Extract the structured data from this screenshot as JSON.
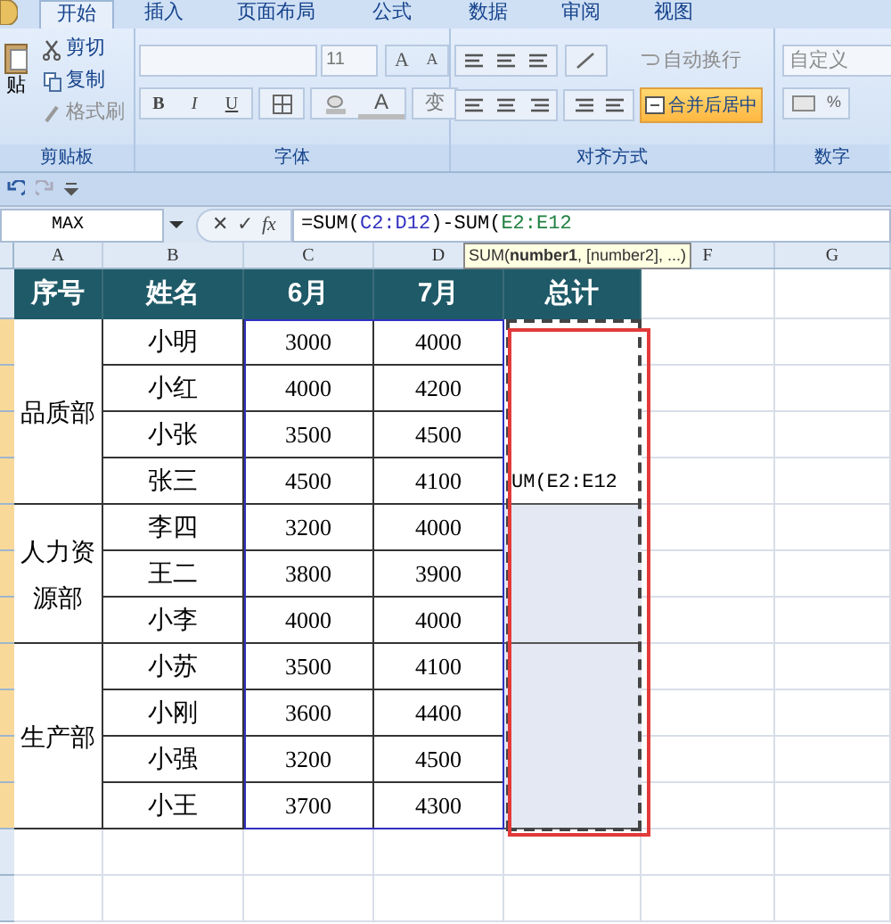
{
  "tabs": [
    {
      "label": "开始",
      "selected": true
    },
    {
      "label": "插入",
      "selected": false
    },
    {
      "label": "页面布局",
      "selected": false
    },
    {
      "label": "公式",
      "selected": false
    },
    {
      "label": "数据",
      "selected": false
    },
    {
      "label": "审阅",
      "selected": false
    },
    {
      "label": "视图",
      "selected": false
    }
  ],
  "clipboard": {
    "paste": "贴",
    "items": [
      {
        "label": "剪切",
        "disabled": false
      },
      {
        "label": "复制",
        "disabled": false
      },
      {
        "label": "格式刷",
        "disabled": true
      }
    ],
    "group_label": "剪贴板"
  },
  "font": {
    "size": "11",
    "grow": "A",
    "shrink": "A",
    "bold": "B",
    "italic": "I",
    "underline": "U",
    "font_color": "A",
    "phonetic": "变",
    "group_label": "字体"
  },
  "alignment": {
    "wrap": {
      "label": "自动换行",
      "disabled": true
    },
    "merge": {
      "label": "合并后居中",
      "selected": true
    },
    "group_label": "对齐方式"
  },
  "number": {
    "format": "自定义",
    "percent": "%",
    "group_label": "数字"
  },
  "formula_bar": {
    "name_box": "MAX",
    "cancel": "✕",
    "enter": "✓",
    "function": "fx",
    "parts": [
      {
        "text": "=SUM(",
        "color": "#000000"
      },
      {
        "text": "C2:D12",
        "color": "#3030c0"
      },
      {
        "text": ")-SUM(",
        "color": "#000000"
      },
      {
        "text": "E2:E12",
        "color": "#208040"
      }
    ]
  },
  "tooltip": "SUM(**number1**, [number2], ...)",
  "columns": [
    "A",
    "B",
    "C",
    "D",
    "F",
    "G"
  ],
  "header": [
    "序号",
    "姓名",
    "6月",
    "7月",
    "总计"
  ],
  "groups": [
    {
      "department": "品质部",
      "members": [
        {
          "name": "小明",
          "jun": "3000",
          "jul": "4000"
        },
        {
          "name": "小红",
          "jun": "4000",
          "jul": "4200"
        },
        {
          "name": "小张",
          "jun": "3500",
          "jul": "4500"
        },
        {
          "name": "张三",
          "jun": "4500",
          "jul": "4100"
        }
      ],
      "total": {
        "text": "UM(E2:E12",
        "shaded": false
      }
    },
    {
      "department": "人力资源部",
      "members": [
        {
          "name": "李四",
          "jun": "3200",
          "jul": "4000"
        },
        {
          "name": "王二",
          "jun": "3800",
          "jul": "3900"
        },
        {
          "name": "小李",
          "jun": "4000",
          "jul": "4000"
        }
      ],
      "total": {
        "shaded": true
      }
    },
    {
      "department": "生产部",
      "members": [
        {
          "name": "小苏",
          "jun": "3500",
          "jul": "4100"
        },
        {
          "name": "小刚",
          "jun": "3600",
          "jul": "4400"
        },
        {
          "name": "小强",
          "jun": "3200",
          "jul": "4500"
        },
        {
          "name": "小王",
          "jun": "3700",
          "jul": "4300"
        }
      ],
      "total": {
        "shaded": true
      }
    }
  ],
  "row_headers": [
    {
      "selected": false
    },
    {
      "selected": true
    },
    {
      "selected": true
    },
    {
      "selected": true
    },
    {
      "selected": true
    },
    {
      "selected": true
    },
    {
      "selected": true
    },
    {
      "selected": true
    },
    {
      "selected": true
    },
    {
      "selected": true
    },
    {
      "selected": true
    },
    {
      "selected": true
    },
    {
      "selected": false
    },
    {
      "selected": false
    }
  ]
}
